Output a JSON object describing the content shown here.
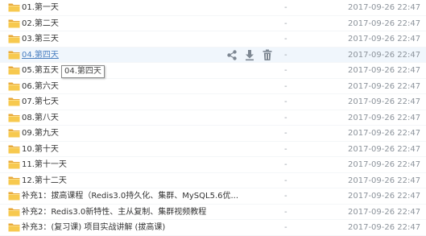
{
  "files": [
    {
      "name": "01.第一天",
      "size": "-",
      "date": "2017-09-26 22:47"
    },
    {
      "name": "02.第二天",
      "size": "-",
      "date": "2017-09-26 22:47"
    },
    {
      "name": "03.第三天",
      "size": "-",
      "date": "2017-09-26 22:47"
    },
    {
      "name": "04.第四天",
      "size": "-",
      "date": "2017-09-26 22:47"
    },
    {
      "name": "05.第五天",
      "size": "-",
      "date": "2017-09-26 22:47"
    },
    {
      "name": "06.第六天",
      "size": "-",
      "date": "2017-09-26 22:47"
    },
    {
      "name": "07.第七天",
      "size": "-",
      "date": "2017-09-26 22:47"
    },
    {
      "name": "08.第八天",
      "size": "-",
      "date": "2017-09-26 22:47"
    },
    {
      "name": "09.第九天",
      "size": "-",
      "date": "2017-09-26 22:47"
    },
    {
      "name": "10.第十天",
      "size": "-",
      "date": "2017-09-26 22:47"
    },
    {
      "name": "11.第十一天",
      "size": "-",
      "date": "2017-09-26 22:47"
    },
    {
      "name": "12.第十二天",
      "size": "-",
      "date": "2017-09-26 22:47"
    },
    {
      "name": "补充1：拔高课程（Redis3.0持久化、集群、MySQL5.6优...",
      "size": "-",
      "date": "2017-09-26 22:47"
    },
    {
      "name": "补充2：Redis3.0新特性、主从复制、集群视频教程",
      "size": "-",
      "date": "2017-09-26 22:47"
    },
    {
      "name": "补充3：(复习课) 项目实战讲解 (拔高课)",
      "size": "-",
      "date": "2017-09-26 22:47"
    }
  ],
  "hover_row_index": 3,
  "hover_actions": [
    {
      "label": "share",
      "icon": "share-icon"
    },
    {
      "label": "download",
      "icon": "download-icon"
    },
    {
      "label": "delete",
      "icon": "trash-icon"
    }
  ],
  "tooltip_text": "04.第四天",
  "colors": {
    "folder": "#f5c242",
    "hover_bg": "#f0f6fc",
    "link": "#4a7fc0",
    "date": "#8c939b"
  }
}
